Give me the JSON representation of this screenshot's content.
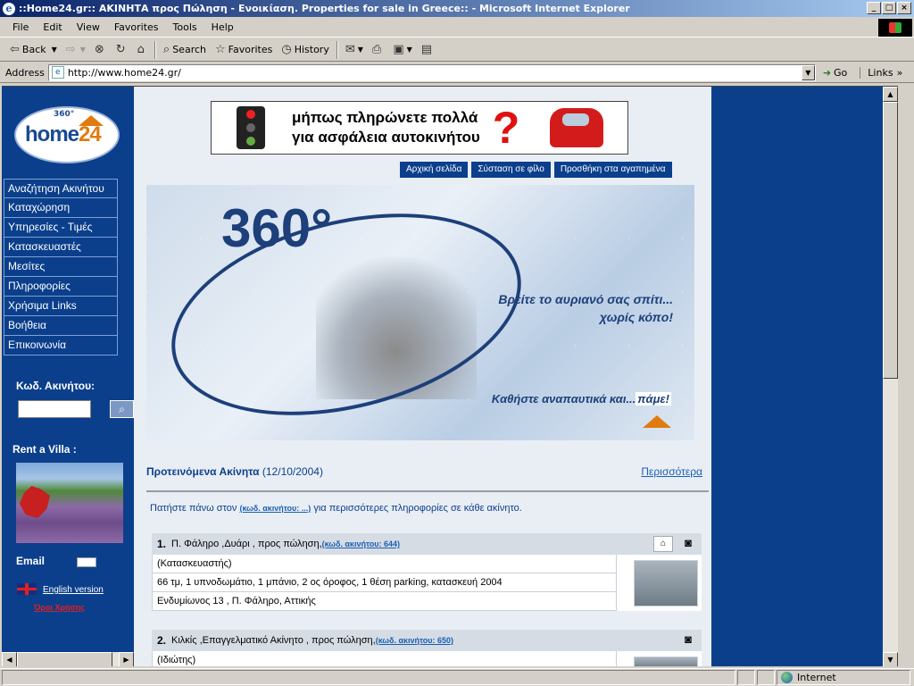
{
  "window": {
    "title": "::Home24.gr:: ΑΚΙΝΗΤΑ προς Πώληση - Ενοικίαση.  Properties for sale in Greece:: - Microsoft Internet Explorer"
  },
  "menu": {
    "items": [
      "File",
      "Edit",
      "View",
      "Favorites",
      "Tools",
      "Help"
    ]
  },
  "toolbar": {
    "back": "Back",
    "search": "Search",
    "favorites": "Favorites",
    "history": "History"
  },
  "address": {
    "label": "Address",
    "url": "http://www.home24.gr/",
    "go": "Go",
    "links": "Links"
  },
  "site": {
    "logo_360": "360°",
    "logo_text": "home",
    "logo_num": "24",
    "nav": [
      "Αναζήτηση Ακινήτου",
      "Καταχώρηση",
      "Υπηρεσίες - Τιμές",
      "Κατασκευαστές",
      "Μεσίτες",
      "Πληροφορίες",
      "Χρήσιμα Links",
      "Βοήθεια",
      "Επικοινωνία"
    ],
    "code_label": "Κωδ. Ακινήτου:",
    "villa_label": "Rent a Villa :",
    "email_label": "Email",
    "english_version": "English version",
    "terms": "Όροι Χρήσης",
    "ad_line1": "μήπως πληρώνετε πολλά",
    "ad_line2": "για ασφάλεια αυτοκινήτου",
    "ad_mark": "?",
    "tabs": [
      "Αρχική σελίδα",
      "Σύσταση σε φίλο",
      "Προσθήκη στα αγαπημένα"
    ],
    "hero_360": "360°",
    "hero_tag1": "Βρείτε το αυριανό σας σπίτι...",
    "hero_tag2": "χωρίς κόπο!",
    "hero_tag3": "Καθήστε αναπαυτικά και...",
    "hero_tag3b": "πάμε!",
    "featured_title": "Προτεινόμενα Ακίνητα",
    "featured_date": "(12/10/2004)",
    "featured_more": "Περισσότερα",
    "hint_pre": "Πατήστε πάνω στον ",
    "hint_link": "(κωδ. ακινήτου: ...)",
    "hint_post": " για περισσότερες πληροφορίες σε κάθε ακίνητο.",
    "listings": [
      {
        "num": "1.",
        "title": "Π. Φάληρο ,Δυάρι , προς πώληση,",
        "code": "(κωδ. ακινήτου: 644)",
        "seller": "(Κατασκευαστής)",
        "details": "66 τμ, 1  υπνοδωμάτιο, 1  μπάνιο, 2 ος όροφος, 1  θέση parking, κατασκευή 2004",
        "address": "Ενδυμίωνος 13 , Π. Φάληρο, Αττικής"
      },
      {
        "num": "2.",
        "title": "Κιλκίς ,Επαγγελματικό Ακίνητο , προς πώληση,",
        "code": "(κωδ. ακινήτου: 650)",
        "seller": "(Ιδιώτης)"
      }
    ]
  },
  "status": {
    "zone": "Internet"
  }
}
